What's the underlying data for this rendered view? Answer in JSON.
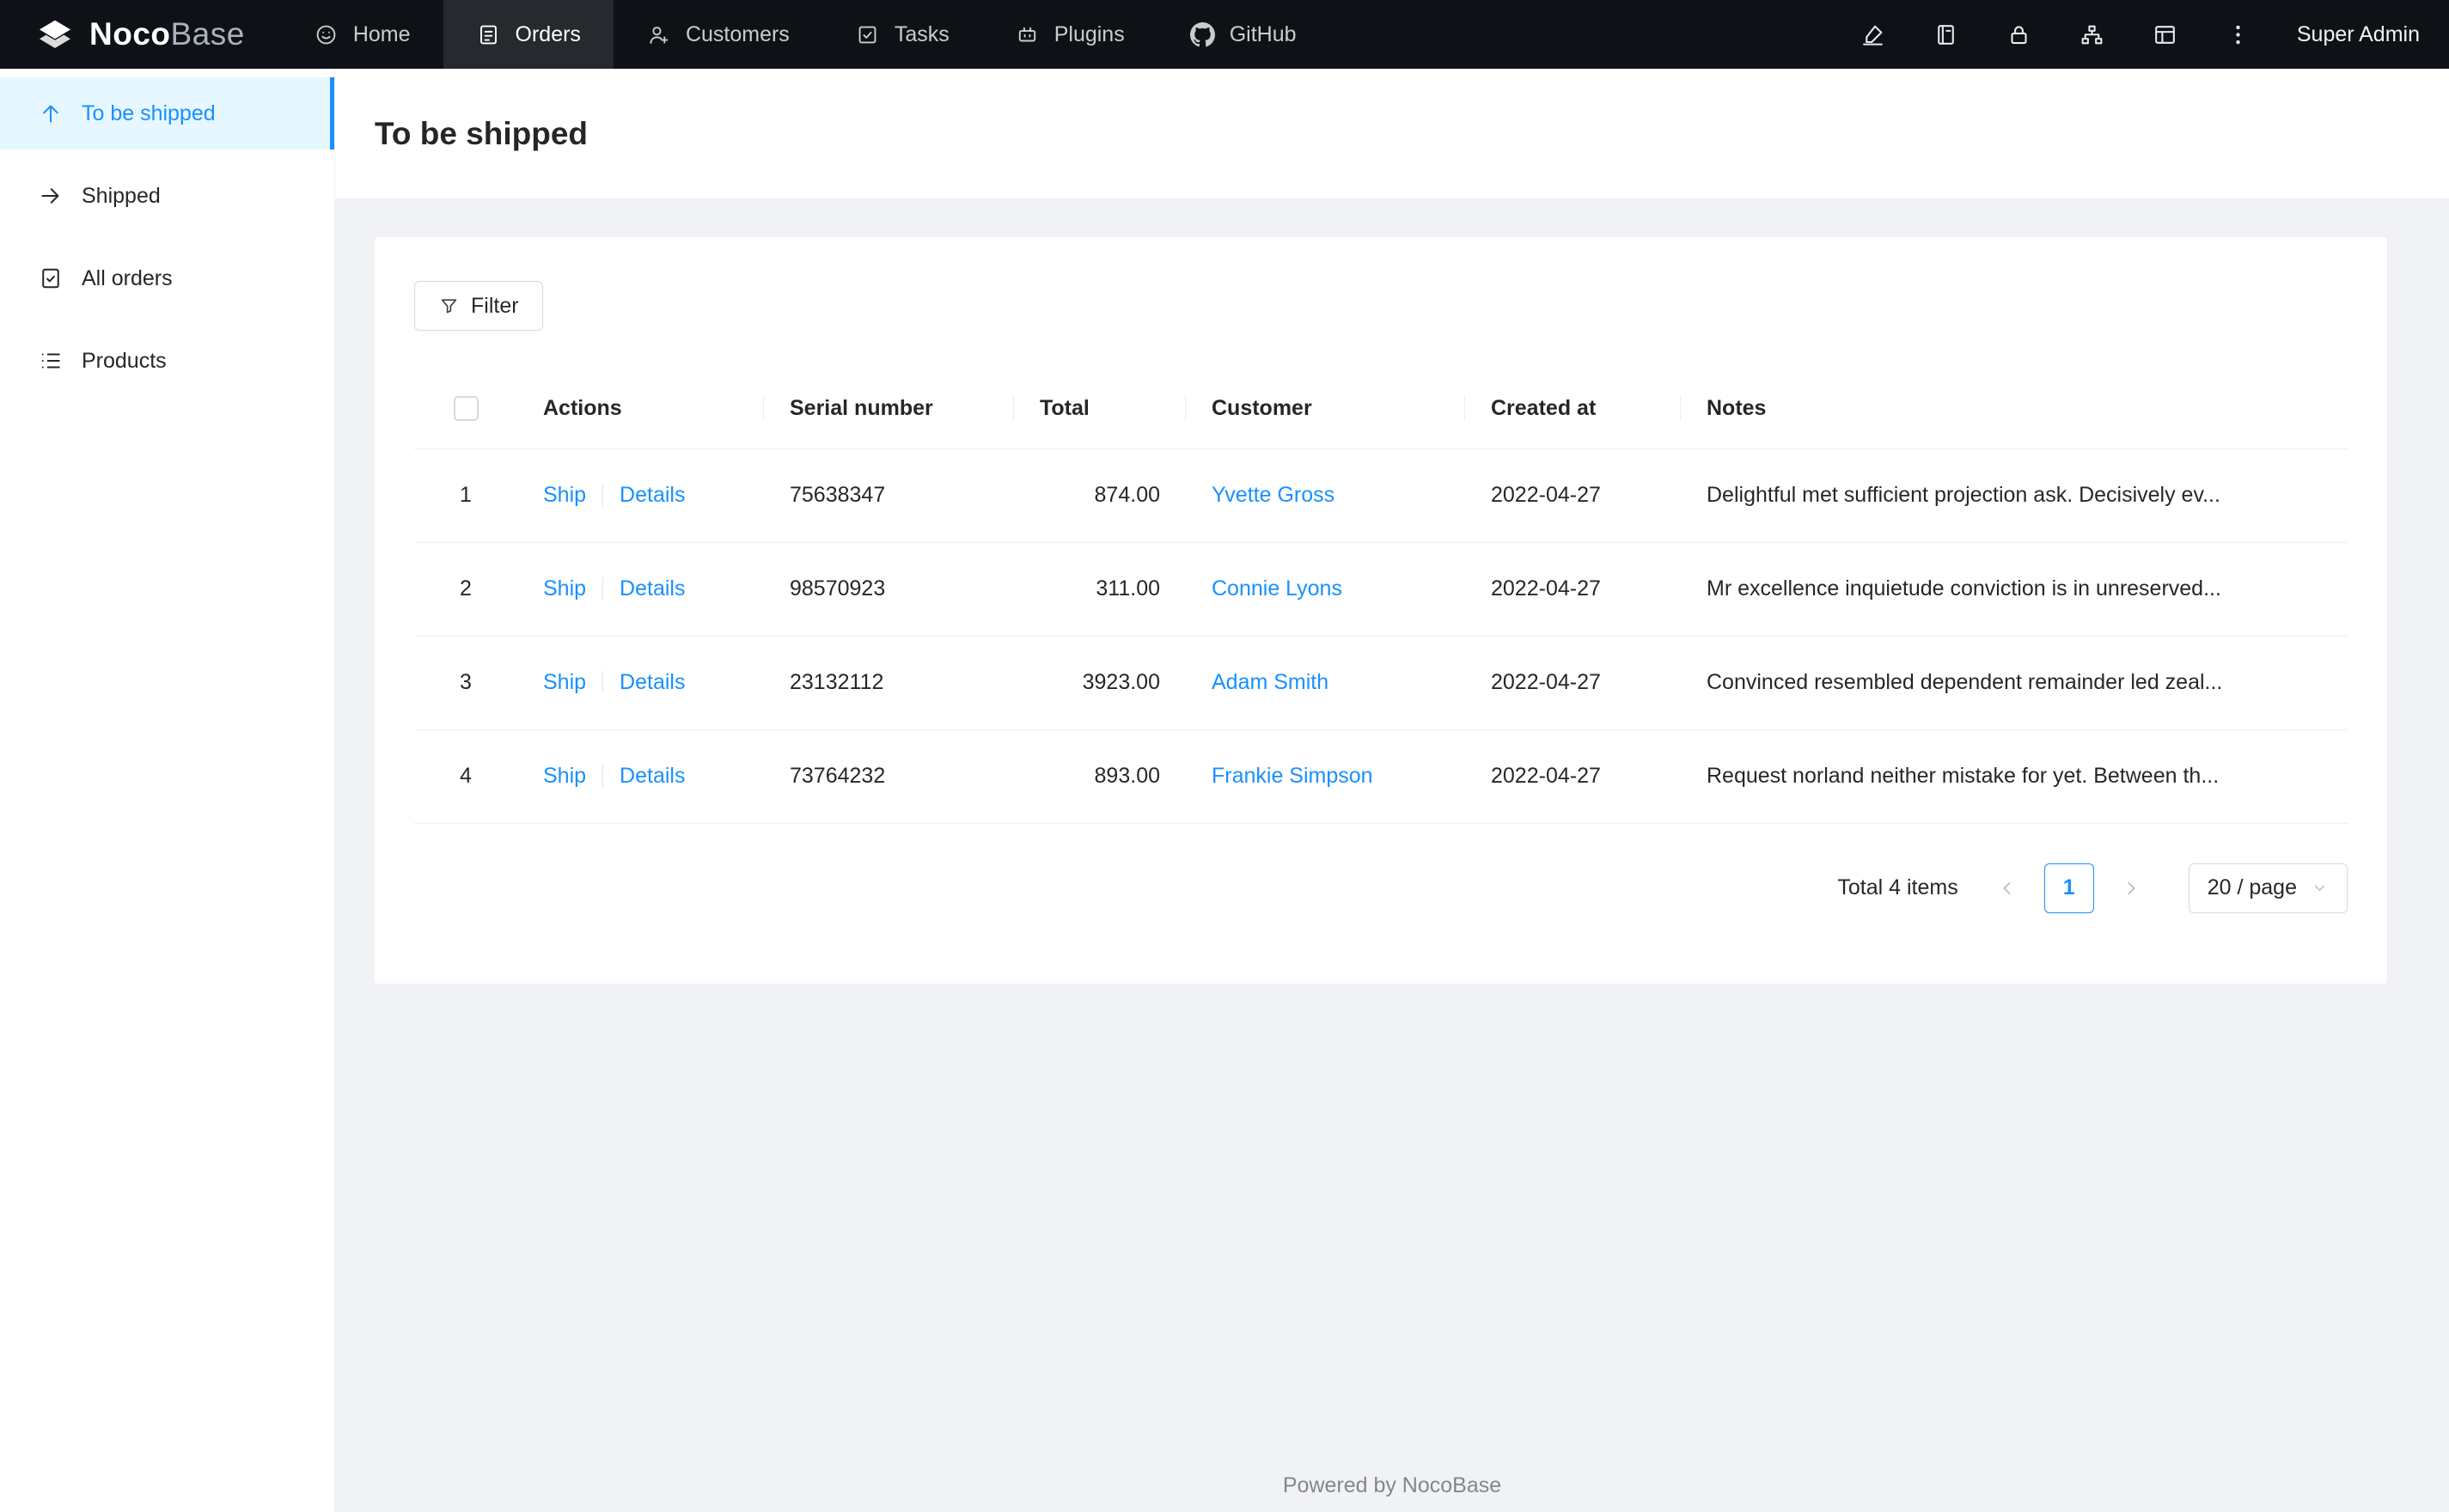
{
  "colors": {
    "accent": "#1890ff",
    "link": "#1890ff",
    "topbar_bg": "#0e1217",
    "sidebar_active_bg": "#e6f7ff",
    "content_bg": "#f0f2f5"
  },
  "header": {
    "logo": {
      "bold": "Noco",
      "light": "Base",
      "icon": "nocobase-logo-icon"
    },
    "nav": [
      {
        "label": "Home",
        "icon": "smile-icon",
        "active": false
      },
      {
        "label": "Orders",
        "icon": "orders-icon",
        "active": true
      },
      {
        "label": "Customers",
        "icon": "customers-icon",
        "active": false
      },
      {
        "label": "Tasks",
        "icon": "tasks-icon",
        "active": false
      },
      {
        "label": "Plugins",
        "icon": "plugins-icon",
        "active": false
      },
      {
        "label": "GitHub",
        "icon": "github-icon",
        "active": false
      }
    ],
    "tools": [
      {
        "icon": "highlighter-icon"
      },
      {
        "icon": "book-icon"
      },
      {
        "icon": "lock-icon"
      },
      {
        "icon": "apartment-icon"
      },
      {
        "icon": "layout-icon"
      },
      {
        "icon": "more-icon"
      }
    ],
    "user": "Super Admin"
  },
  "sidebar": {
    "items": [
      {
        "label": "To be shipped",
        "icon": "arrow-up-icon",
        "active": true
      },
      {
        "label": "Shipped",
        "icon": "arrow-right-icon",
        "active": false
      },
      {
        "label": "All orders",
        "icon": "file-done-icon",
        "active": false
      },
      {
        "label": "Products",
        "icon": "list-icon",
        "active": false
      }
    ]
  },
  "page": {
    "title": "To be shipped"
  },
  "toolbar": {
    "filter_label": "Filter",
    "filter_icon": "filter-icon"
  },
  "table": {
    "columns": [
      "Actions",
      "Serial number",
      "Total",
      "Customer",
      "Created at",
      "Notes"
    ],
    "rows": [
      {
        "index": "1",
        "actions": [
          "Ship",
          "Details"
        ],
        "serial": "75638347",
        "total": "874.00",
        "customer": "Yvette Gross",
        "created_at": "2022-04-27",
        "notes": "Delightful met sufficient projection ask. Decisively ev..."
      },
      {
        "index": "2",
        "actions": [
          "Ship",
          "Details"
        ],
        "serial": "98570923",
        "total": "311.00",
        "customer": "Connie Lyons",
        "created_at": "2022-04-27",
        "notes": "Mr excellence inquietude conviction is in unreserved..."
      },
      {
        "index": "3",
        "actions": [
          "Ship",
          "Details"
        ],
        "serial": "23132112",
        "total": "3923.00",
        "customer": "Adam Smith",
        "created_at": "2022-04-27",
        "notes": "Convinced resembled dependent remainder led zeal..."
      },
      {
        "index": "4",
        "actions": [
          "Ship",
          "Details"
        ],
        "serial": "73764232",
        "total": "893.00",
        "customer": "Frankie Simpson",
        "created_at": "2022-04-27",
        "notes": "Request norland neither mistake for yet. Between th..."
      }
    ]
  },
  "pagination": {
    "total_text": "Total 4 items",
    "current_page": "1",
    "page_size": "20 / page"
  },
  "footer": {
    "text": "Powered by NocoBase"
  }
}
